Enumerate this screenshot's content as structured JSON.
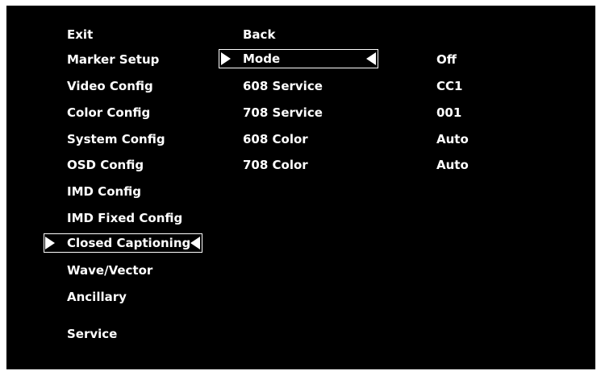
{
  "menu": {
    "items": [
      {
        "label": "Exit"
      },
      {
        "label": "Marker Setup"
      },
      {
        "label": "Video Config"
      },
      {
        "label": "Color Config"
      },
      {
        "label": "System Config"
      },
      {
        "label": "OSD Config"
      },
      {
        "label": "IMD Config"
      },
      {
        "label": "IMD Fixed Config"
      },
      {
        "label": "Closed Captioning"
      },
      {
        "label": "Wave/Vector"
      },
      {
        "label": "Ancillary"
      },
      {
        "label": "Service"
      }
    ],
    "selected_index": 8
  },
  "submenu": {
    "back_label": "Back",
    "settings": [
      {
        "label": "Mode",
        "value": "Off"
      },
      {
        "label": "608 Service",
        "value": "CC1"
      },
      {
        "label": "708 Service",
        "value": "001"
      },
      {
        "label": "608 Color",
        "value": "Auto"
      },
      {
        "label": "708 Color",
        "value": "Auto"
      }
    ],
    "selected_index": 0
  },
  "colors": {
    "background": "#000000",
    "text": "#ffffff",
    "page": "#ffffff"
  },
  "icons": {
    "selection_left": "triangle-right-icon",
    "selection_right": "triangle-left-icon"
  }
}
